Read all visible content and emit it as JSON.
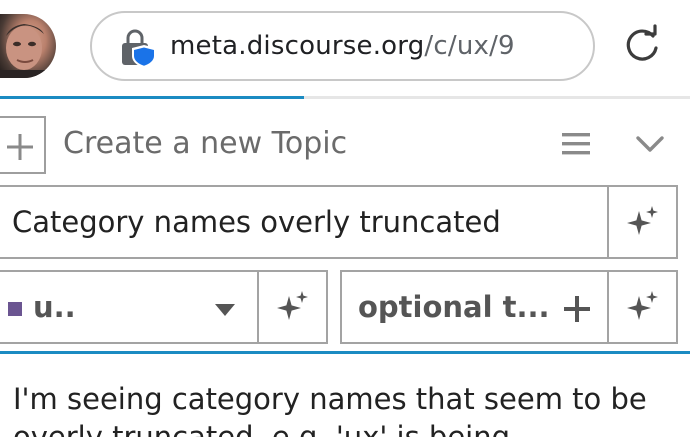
{
  "browser": {
    "url_domain": "meta.discourse.org",
    "url_path": "/c/ux/9",
    "lock_icon": "lock-shield-icon",
    "reload_icon": "reload-icon",
    "accent_color": "#1b8bc2"
  },
  "load_progress": 0.44,
  "composer": {
    "add_icon": "plus-icon",
    "header_title": "Create a new Topic",
    "menu_icon": "hamburger-icon",
    "collapse_icon": "chevron-down-icon",
    "title_value": "Category names overly truncated",
    "category": {
      "name": "u..",
      "color": "#6b5591"
    },
    "tags_placeholder": "optional t...",
    "body_text": "I'm seeing category names that seem to be overly truncated, e.g. 'ux' is being"
  }
}
